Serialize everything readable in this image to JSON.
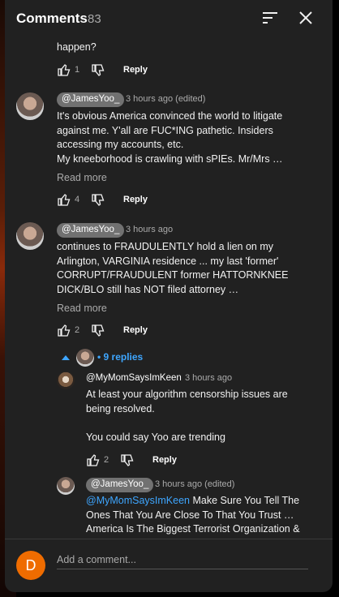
{
  "header": {
    "title": "Comments",
    "count": "83"
  },
  "top_fragment": {
    "text": "happen?",
    "likes": "1",
    "reply": "Reply"
  },
  "comments": [
    {
      "handle": "@JamesYoo_",
      "time": "3 hours ago (edited)",
      "lines": [
        "It's obvious America convinced the world to litigate",
        "against me. Y'all are FUC*ING pathetic. Insiders",
        "accessing my accounts, etc.",
        "My kneeborhood is crawling with sPIEs. Mr/Mrs …"
      ],
      "read_more": "Read more",
      "likes": "4",
      "reply": "Reply"
    },
    {
      "handle": "@JamesYoo_",
      "time": "3 hours ago",
      "lines": [
        "continues to FRAUDULENTLY hold a lien on my",
        "Arlington, VARGINIA residence ... my last 'former'",
        "CORRUPT/FRAUDULENT former HATTORNKNEE",
        "DICK/BLO still has NOT filed attorney …"
      ],
      "read_more": "Read more",
      "likes": "2",
      "reply": "Reply",
      "replies_label": "• 9 replies"
    }
  ],
  "replies": [
    {
      "handle": "@MyMomSaysImKeen",
      "time": "3 hours ago",
      "lines": [
        "At least your algorithm censorship issues are",
        "being resolved.",
        "",
        "You could say Yoo are trending"
      ],
      "likes": "2",
      "reply": "Reply"
    },
    {
      "handle": "@JamesYoo_",
      "time": "3 hours ago (edited)",
      "mention": "@MyMomSaysImKeen",
      "first_line_rest": " Make Sure You Tell The",
      "lines": [
        "Ones That You Are Close To That You Trust …",
        "America Is The Biggest Terrorist Organization &"
      ]
    }
  ],
  "footer": {
    "avatar_letter": "D",
    "placeholder": "Add a comment..."
  },
  "colors": {
    "panel": "#212121",
    "link": "#3ea6ff",
    "avatar_me": "#ef6c00"
  }
}
